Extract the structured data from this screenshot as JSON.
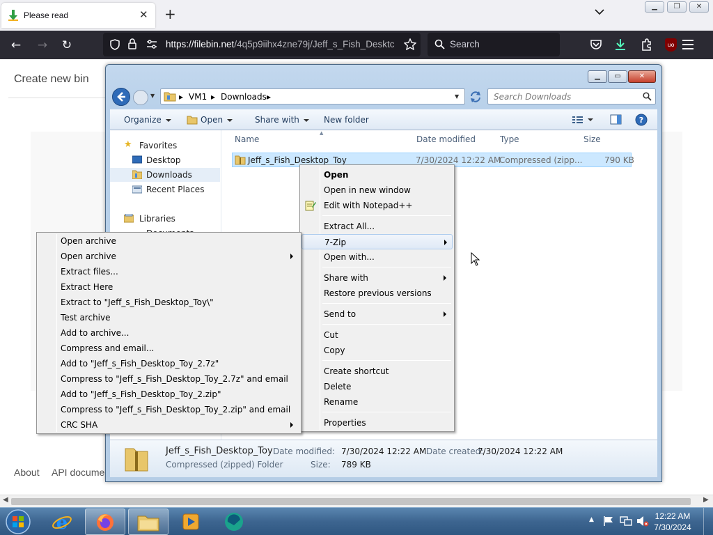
{
  "browser": {
    "tab_title": "Please read",
    "url_host": "https://filebin.net",
    "url_path": "/4q5p9iihx4zne79j/Jeff_s_Fish_Desktc",
    "search_placeholder": "Search",
    "ublock_badge": "uo"
  },
  "page": {
    "create_bin": "Create new bin",
    "footer_about": "About",
    "footer_api": "API documer"
  },
  "explorer": {
    "breadcrumb": [
      "VM1",
      "Downloads"
    ],
    "search_placeholder": "Search Downloads",
    "toolbar": {
      "organize": "Organize",
      "open": "Open",
      "share_with": "Share with",
      "new_folder": "New folder"
    },
    "nav": {
      "favorites": "Favorites",
      "desktop": "Desktop",
      "downloads": "Downloads",
      "recent": "Recent Places",
      "libraries": "Libraries",
      "documents": "Documents"
    },
    "columns": {
      "name": "Name",
      "date": "Date modified",
      "type": "Type",
      "size": "Size"
    },
    "file": {
      "name": "Jeff_s_Fish_Desktop_Toy",
      "date": "7/30/2024 12:22 AM",
      "type": "Compressed (zipp...",
      "size": "790 KB"
    },
    "details": {
      "name": "Jeff_s_Fish_Desktop_Toy",
      "kind": "Compressed (zipped) Folder",
      "date_modified_label": "Date modified:",
      "date_modified": "7/30/2024 12:22 AM",
      "date_created_label": "Date created:",
      "date_created": "7/30/2024 12:22 AM",
      "size_label": "Size:",
      "size": "789 KB"
    }
  },
  "context_menu": {
    "open": "Open",
    "open_new_window": "Open in new window",
    "edit_notepad": "Edit with Notepad++",
    "extract_all": "Extract All...",
    "seven_zip": "7-Zip",
    "open_with": "Open with...",
    "share_with": "Share with",
    "restore": "Restore previous versions",
    "send_to": "Send to",
    "cut": "Cut",
    "copy": "Copy",
    "create_shortcut": "Create shortcut",
    "delete": "Delete",
    "rename": "Rename",
    "properties": "Properties"
  },
  "zip_menu": {
    "items": [
      "Open archive",
      "Open archive",
      "Extract files...",
      "Extract Here",
      "Extract to \"Jeff_s_Fish_Desktop_Toy\\\"",
      "Test archive",
      "Add to archive...",
      "Compress and email...",
      "Add to \"Jeff_s_Fish_Desktop_Toy_2.7z\"",
      "Compress to \"Jeff_s_Fish_Desktop_Toy_2.7z\" and email",
      "Add to \"Jeff_s_Fish_Desktop_Toy_2.zip\"",
      "Compress to \"Jeff_s_Fish_Desktop_Toy_2.zip\" and email",
      "CRC SHA"
    ]
  },
  "taskbar": {
    "time": "12:22 AM",
    "date": "7/30/2024"
  }
}
